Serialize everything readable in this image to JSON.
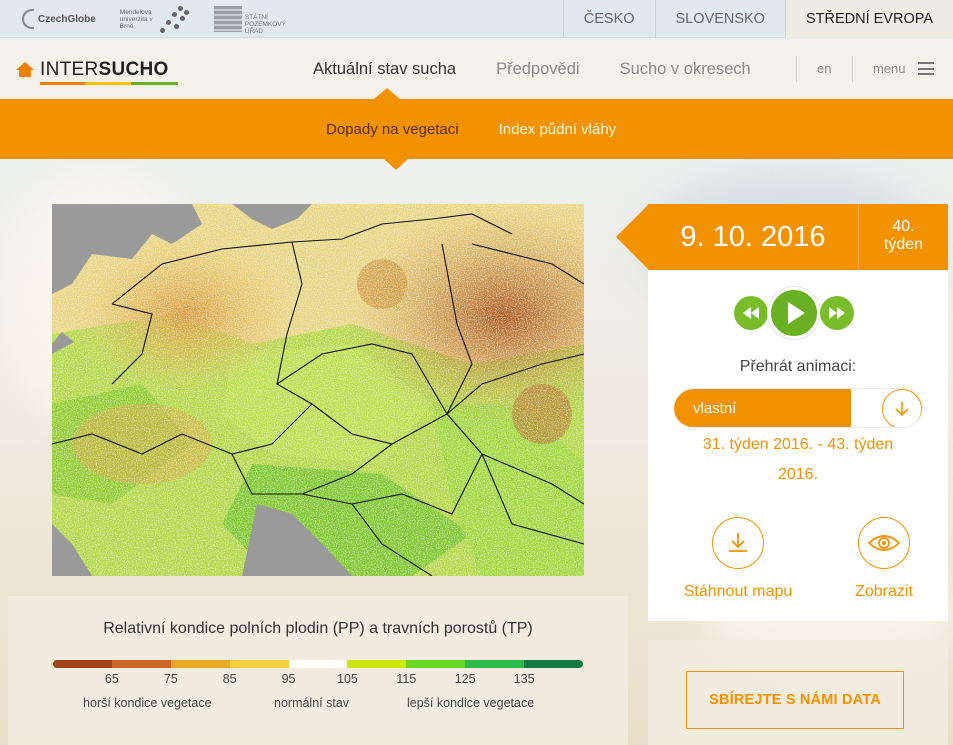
{
  "logos": {
    "czechglobe": "CzechGlobe",
    "mendel": "Mendelova univerzita v Brně",
    "spu": "STÁTNÍ POZEMKOVÝ ÚŘAD"
  },
  "regions": [
    "ČESKO",
    "SLOVENSKO",
    "STŘEDNÍ EVROPA"
  ],
  "active_region": "STŘEDNÍ EVROPA",
  "brand": {
    "part1": "INTER",
    "part2": "SUCHO"
  },
  "nav": {
    "items": [
      "Aktuální stav sucha",
      "Předpovědi",
      "Sucho v okresech"
    ],
    "lang": "en",
    "menu": "menu"
  },
  "subnav": {
    "items": [
      "Dopady na vegetaci",
      "Index půdní vláhy"
    ]
  },
  "date_panel": {
    "date": "9. 10. 2016",
    "week_number": "40.",
    "week_word": "týden"
  },
  "player": {
    "animation_label": "Přehrát animaci:",
    "select_value": "vlastní",
    "range_text": "31. týden 2016. - 43. týden 2016.",
    "download_label": "Stáhnout mapu",
    "view_label": "Zobrazit"
  },
  "legend": {
    "title": "Relativní kondice polních plodin (PP) a travních porostů (TP)",
    "ticks": [
      "65",
      "75",
      "85",
      "95",
      "105",
      "115",
      "125",
      "135"
    ],
    "colors": [
      "#a0441c",
      "#c8682a",
      "#e8a828",
      "#f6d040",
      "#ffffff",
      "#cce80f",
      "#6ed428",
      "#2fb84a",
      "#127a40"
    ],
    "labels": [
      "horší kondice vegetace",
      "normální stav",
      "lepší kondice vegetace"
    ]
  },
  "cta": {
    "label": "SBÍREJTE S NÁMI DATA"
  },
  "colors": {
    "accent": "#f39200",
    "green": "#6ab023"
  }
}
